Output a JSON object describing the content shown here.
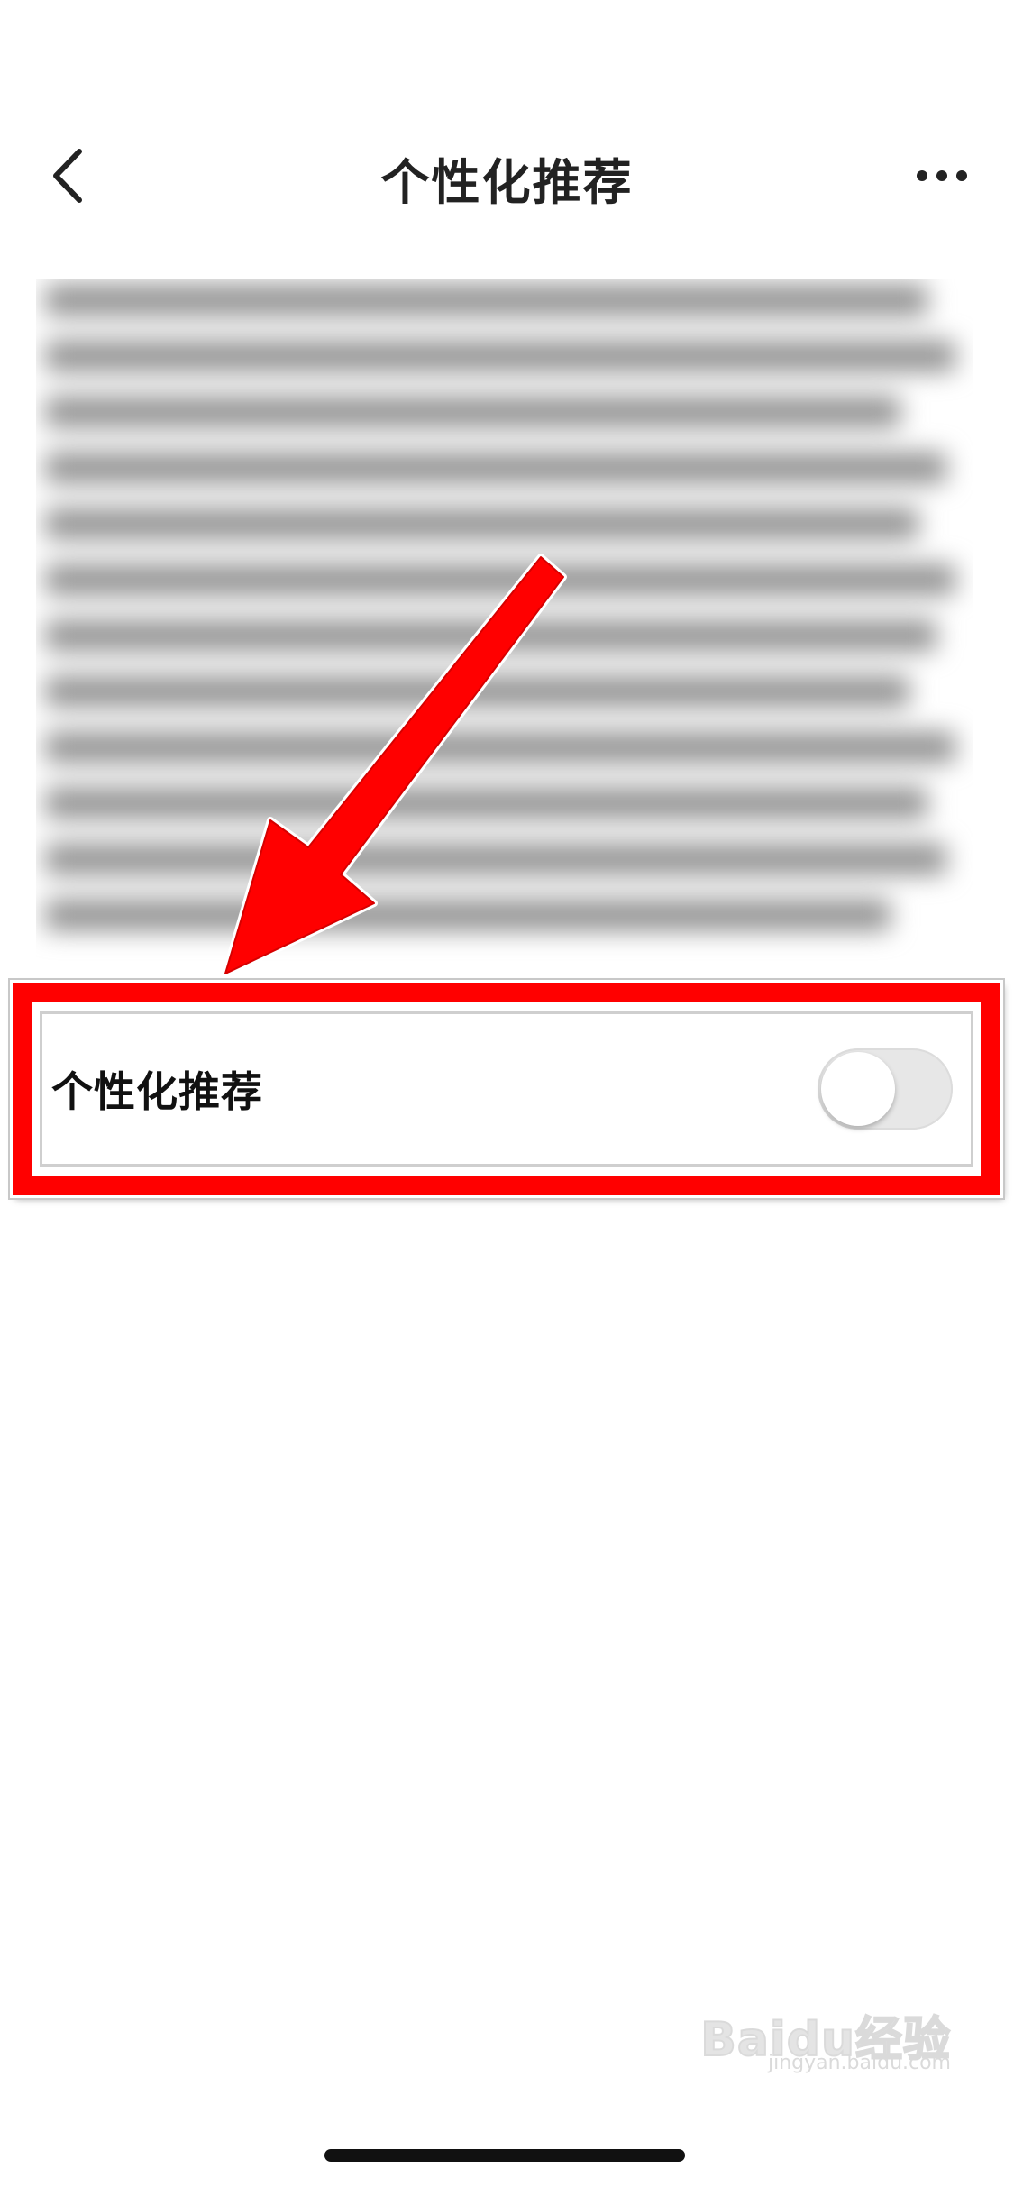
{
  "header": {
    "title": "个性化推荐",
    "back_icon": "chevron-left-icon",
    "more_icon": "more-horizontal-icon"
  },
  "setting": {
    "label": "个性化推荐",
    "toggle_on": false
  },
  "annotation": {
    "color": "#ff0000"
  },
  "watermark": {
    "logo": "Baidu经验",
    "site": "jingyan.baidu.com"
  }
}
